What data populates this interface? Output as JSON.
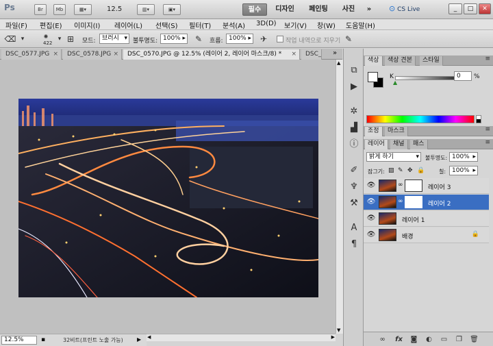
{
  "appbar": {
    "logo": "Ps",
    "bridge": "Br",
    "minibridge": "Mb",
    "zoom": "12.5",
    "workspaces": [
      "필수",
      "디자인",
      "페인팅",
      "사진"
    ],
    "more": "»",
    "cs_live": "CS Live",
    "minimize": "_",
    "restore": "□",
    "close": "✕"
  },
  "menu": [
    "파일(F)",
    "편집(E)",
    "이미지(I)",
    "레이어(L)",
    "선택(S)",
    "필터(T)",
    "분석(A)",
    "3D(D)",
    "보기(V)",
    "창(W)",
    "도움말(H)"
  ],
  "options": {
    "brush_size": "422",
    "mode_label": "모드:",
    "mode_value": "브러시",
    "opacity_label": "불투명도:",
    "opacity_value": "100%",
    "flow_label": "흐름:",
    "flow_value": "100%",
    "erase_history": "작업 내역으로 지우기"
  },
  "tabs": [
    {
      "label": "DSC_0577.JPG",
      "active": false
    },
    {
      "label": "DSC_0578.JPG",
      "active": false
    },
    {
      "label": "DSC_0570.JPG @ 12.5% (레이어 2, 레이어 마스크/8) *",
      "active": true
    },
    {
      "label": "DSC_",
      "active": false
    }
  ],
  "tab_close": "×",
  "tabs_more": "»",
  "status": {
    "zoom": "12.5%",
    "info": "32비트(프린트 노출 가능)"
  },
  "color_panel": {
    "tabs": [
      "색상",
      "색상 견본",
      "스타일"
    ],
    "k_label": "K",
    "k_value": "0",
    "k_unit": "%",
    "k_level_percent": 0
  },
  "adjust_panel": {
    "tabs": [
      "조정",
      "마스크"
    ]
  },
  "layers_panel": {
    "tabs": [
      "레이어",
      "채널",
      "패스"
    ],
    "blend_mode": "밝게 하기",
    "opacity_label": "불투명도:",
    "opacity_value": "100%",
    "lock_label": "잠그기:",
    "fill_label": "칠:",
    "fill_value": "100%",
    "layers": [
      {
        "name": "레이어 3",
        "has_mask": true,
        "selected": false,
        "locked": false
      },
      {
        "name": "레이어 2",
        "has_mask": true,
        "selected": true,
        "locked": false
      },
      {
        "name": "레이어 1",
        "has_mask": false,
        "selected": false,
        "locked": false
      },
      {
        "name": "배경",
        "has_mask": false,
        "selected": false,
        "locked": true
      }
    ]
  },
  "colors": {
    "accent": "#3a6ec2",
    "canvas_bg": "#c0c0c0"
  }
}
